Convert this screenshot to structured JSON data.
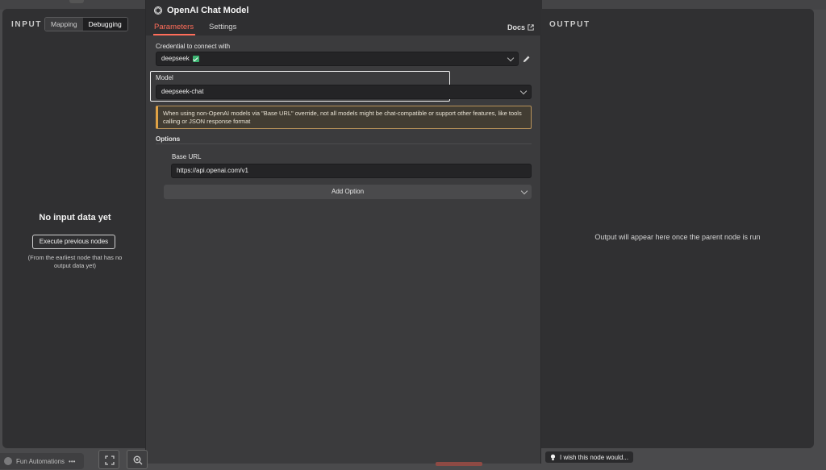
{
  "modal": {
    "title": "OpenAI Chat Model",
    "tabs": {
      "parameters": "Parameters",
      "settings": "Settings"
    },
    "docs": "Docs",
    "credential": {
      "label": "Credential to connect with",
      "value": "deepseek"
    },
    "model": {
      "label": "Model",
      "value": "deepseek-chat"
    },
    "notice": "When using non-OpenAI models via \"Base URL\" override, not all models might be chat-compatible or support other features, like tools calling or JSON response format",
    "options": {
      "label": "Options",
      "base_url": {
        "label": "Base URL",
        "value": "https://api.openai.com/v1"
      },
      "add_option": "Add Option"
    }
  },
  "input": {
    "title": "INPUT",
    "toggle": {
      "mapping": "Mapping",
      "debugging": "Debugging",
      "active": "Debugging"
    },
    "empty_title": "No input data yet",
    "execute_button": "Execute previous nodes",
    "hint": "(From the earliest node that has no output data yet)"
  },
  "output": {
    "title": "OUTPUT",
    "message": "Output will appear here once the parent node is run"
  },
  "feedback": {
    "label": "I wish this node would..."
  },
  "workspace": {
    "name": "Fun Automations",
    "more": "•••"
  },
  "colors": {
    "accent": "#ff6d5a",
    "success": "#3cb371",
    "warning": "#e0a245"
  }
}
